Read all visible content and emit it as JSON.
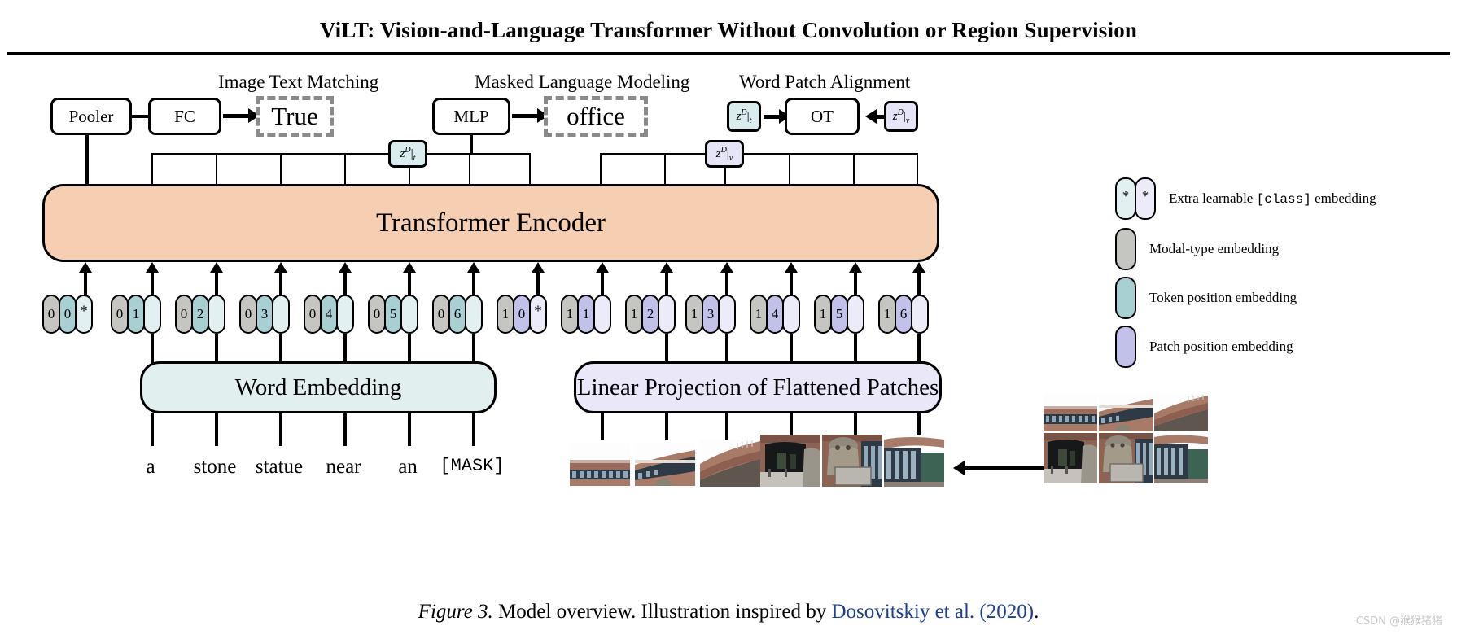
{
  "paper": {
    "title": "ViLT: Vision-and-Language Transformer Without Convolution or Region Supervision",
    "caption_figno": "Figure 3.",
    "caption_text": " Model overview. Illustration inspired by ",
    "caption_cite_author": "Dosovitskiy et al.",
    "caption_cite_year": " (2020)",
    "caption_end": ".",
    "watermark": "CSDN @猴猴猪猪"
  },
  "heads": {
    "itm": {
      "label": "Image Text Matching",
      "pooler": "Pooler",
      "fc": "FC",
      "output": "True"
    },
    "mlm": {
      "label": "Masked Language Modeling",
      "mlp": "MLP",
      "output": "office"
    },
    "wpa": {
      "label": "Word Patch Alignment",
      "ot": "OT",
      "left_token": "z",
      "left_token_sup": "D",
      "left_token_sub": "t",
      "right_token": "z",
      "right_token_sup": "D",
      "right_token_sub": "v"
    }
  },
  "encoder": {
    "label": "Transformer Encoder"
  },
  "z_tokens": {
    "text": {
      "base": "z",
      "sup": "D",
      "sub": "t"
    },
    "visual": {
      "base": "z",
      "sup": "D",
      "sub": "v"
    }
  },
  "embeddings": {
    "word": "Word Embedding",
    "patch": "Linear Projection of Flattened Patches"
  },
  "text_tokens": [
    {
      "modal": "0",
      "pos": "0",
      "cls": "*",
      "has_cls": true
    },
    {
      "modal": "0",
      "pos": "1",
      "has_cls": false
    },
    {
      "modal": "0",
      "pos": "2",
      "has_cls": false
    },
    {
      "modal": "0",
      "pos": "3",
      "has_cls": false
    },
    {
      "modal": "0",
      "pos": "4",
      "has_cls": false
    },
    {
      "modal": "0",
      "pos": "5",
      "has_cls": false
    },
    {
      "modal": "0",
      "pos": "6",
      "has_cls": false
    }
  ],
  "image_tokens": [
    {
      "modal": "1",
      "pos": "0",
      "cls": "*",
      "has_cls": true
    },
    {
      "modal": "1",
      "pos": "1",
      "has_cls": false
    },
    {
      "modal": "1",
      "pos": "2",
      "has_cls": false
    },
    {
      "modal": "1",
      "pos": "3",
      "has_cls": false
    },
    {
      "modal": "1",
      "pos": "4",
      "has_cls": false
    },
    {
      "modal": "1",
      "pos": "5",
      "has_cls": false
    },
    {
      "modal": "1",
      "pos": "6",
      "has_cls": false
    }
  ],
  "words": [
    "a",
    "stone",
    "statue",
    "near",
    "an",
    "[MASK]"
  ],
  "legend": [
    {
      "symbol": "*",
      "text_before": "Extra learnable ",
      "text_mono": "[class]",
      "text_after": " embedding",
      "swatches": [
        "#e3f0f1",
        "#ecebf8"
      ]
    },
    {
      "text_before": "Modal-type embedding",
      "swatches": [
        "#c5c5c2"
      ]
    },
    {
      "text_before": "Token position embedding",
      "swatches": [
        "#a8cfd2"
      ]
    },
    {
      "text_before": "Patch position embedding",
      "swatches": [
        "#c2c1ea"
      ]
    }
  ],
  "colors": {
    "encoder_fill": "#f6ceb2",
    "word_embedding_fill": "#e2efef",
    "patch_projection_fill": "#eae7f8",
    "modal_type": "#c5c5c2",
    "token_position": "#a8cfd2",
    "patch_position": "#c2c1ea",
    "text_class": "#e3f0f1",
    "visual_class": "#ecebf8",
    "citation_link": "#1b3f94",
    "dashed_border": "#8a8a8a"
  }
}
